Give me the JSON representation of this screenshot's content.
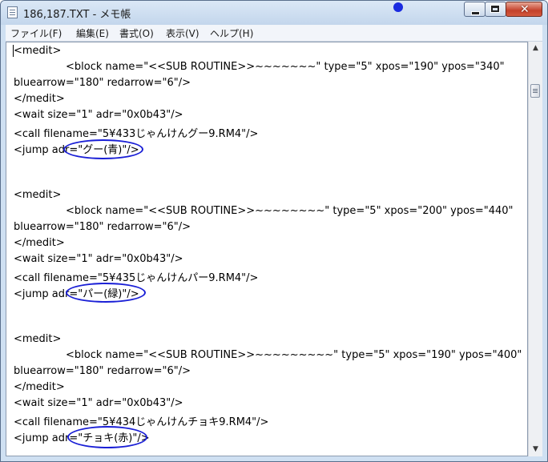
{
  "window": {
    "title": "186,187.TXT - メモ帳"
  },
  "menu": {
    "items": [
      {
        "label": "ファイル(F)"
      },
      {
        "label": "編集(E)"
      },
      {
        "label": "書式(O)"
      },
      {
        "label": "表示(V)"
      },
      {
        "label": "ヘルプ(H)"
      }
    ]
  },
  "editor": {
    "lines": [
      "<medit>",
      "<block name=\"<<SUB ROUTINE>>~~~~~~~\" type=\"5\" xpos=\"190\" ypos=\"340\"",
      "bluearrow=\"180\" redarrow=\"6\"/>",
      "</medit>",
      "<wait size=\"1\" adr=\"0x0b43\"/>",
      "<call filename=\"5¥433じゃんけんグー9.RM4\"/>",
      "<jump adr=\"グー(青)\"/>",
      "",
      "",
      "<medit>",
      "<block name=\"<<SUB ROUTINE>>~~~~~~~~\" type=\"5\" xpos=\"200\" ypos=\"440\"",
      "bluearrow=\"180\" redarrow=\"6\"/>",
      "</medit>",
      "<wait size=\"1\" adr=\"0x0b43\"/>",
      "<call filename=\"5¥435じゃんけんパー9.RM4\"/>",
      "<jump adr=\"パー(緑)\"/>",
      "",
      "",
      "<medit>",
      "<block name=\"<<SUB ROUTINE>>~~~~~~~~~\" type=\"5\" xpos=\"190\" ypos=\"400\"",
      "bluearrow=\"180\" redarrow=\"6\"/>",
      "</medit>",
      "<wait size=\"1\" adr=\"0x0b43\"/>",
      "<call filename=\"5¥434じゃんけんチョキ9.RM4\"/>",
      "<jump adr=\"チョキ(赤)\"/>"
    ]
  },
  "colors": {
    "annotation_ellipse": "#1a1fd6",
    "title_dot": "#1a2be0",
    "close_button": "#c4412a"
  },
  "icons": {
    "app": "notepad-icon",
    "minimize": "minimize-icon",
    "maximize": "maximize-icon",
    "close": "close-icon",
    "scroll_up": "chevron-up-icon",
    "scroll_down": "chevron-down-icon"
  }
}
